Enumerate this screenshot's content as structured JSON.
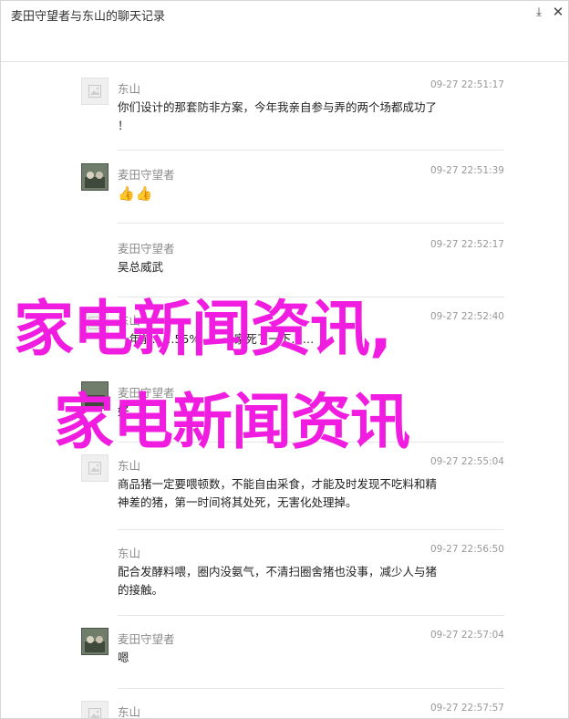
{
  "window": {
    "title": "麦田守望者与东山的聊天记录",
    "edit_glyph": "⤓",
    "close_glyph": "✕"
  },
  "messages": [
    {
      "sender": "东山",
      "time": "09-27 22:51:17",
      "avatar": "placeholder-icon",
      "lines": [
        "你们设计的那套防非方案，今年我亲自参与弄的两个场都成功了",
        "！"
      ]
    },
    {
      "sender": "麦田守望者",
      "time": "09-27 22:51:39",
      "avatar": "user-photo",
      "lines": [
        "👍👍"
      ]
    },
    {
      "sender": "麦田守望者",
      "time": "09-27 22:52:17",
      "avatar": "",
      "lines": [
        "吴总威武"
      ]
    },
    {
      "sender": "东山",
      "time": "09-27 22:52:40",
      "avatar": "placeholder-icon",
      "lines": [
        "一年前……55%……一家死了一下……"
      ]
    },
    {
      "sender": "麦田守望者",
      "time": "",
      "avatar": "user-photo",
      "lines": [
        "好……"
      ]
    },
    {
      "sender": "东山",
      "time": "09-27 22:55:04",
      "avatar": "placeholder-icon",
      "lines": [
        "商品猪一定要喂顿数，不能自由采食，才能及时发现不吃料和精",
        "神差的猪，第一时间将其处死，无害化处理掉。"
      ]
    },
    {
      "sender": "东山",
      "time": "09-27 22:56:50",
      "avatar": "placeholder-icon",
      "lines": [
        "配合发酵料喂，圈内没氨气，不清扫圈舍猪也没事，减少人与猪",
        "的接触。"
      ]
    },
    {
      "sender": "麦田守望者",
      "time": "09-27 22:57:04",
      "avatar": "user-photo",
      "lines": [
        "嗯"
      ]
    },
    {
      "sender": "东山",
      "time": "09-27 22:57:57",
      "avatar": "placeholder-icon",
      "lines": [
        ""
      ]
    }
  ],
  "watermark": {
    "line1": "家电新闻资讯,",
    "line2": "家电新闻资讯",
    "color": "#f01de0"
  }
}
